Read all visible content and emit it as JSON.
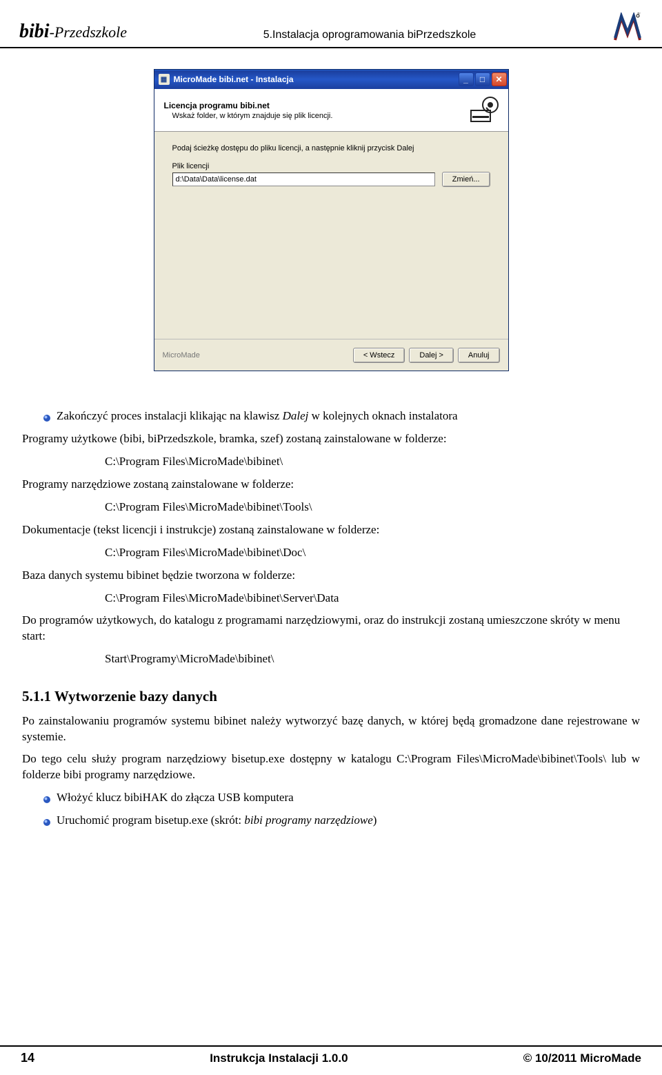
{
  "header": {
    "left_prefix": "bibi",
    "left_suffix": "-Przedszkole",
    "center": "5.Instalacja oprogramowania biPrzedszkole"
  },
  "installer": {
    "title": "MicroMade bibi.net - Instalacja",
    "wiz_title": "Licencja programu bibi.net",
    "wiz_sub": "Wskaż folder, w którym znajduje się plik licencji.",
    "instr": "Podaj ścieżkę dostępu do pliku licencji, a następnie kliknij przycisk Dalej",
    "field_label": "Plik licencji",
    "path_value": "d:\\Data\\Data\\license.dat",
    "btn_change": "Zmień...",
    "brand_footer": "MicroMade",
    "btn_back": "< Wstecz",
    "btn_next": "Dalej >",
    "btn_cancel": "Anuluj"
  },
  "bullets": {
    "b1": "Zakończyć proces instalacji klikając na klawisz ",
    "b1_em": "Dalej",
    "b1_tail": " w kolejnych oknach instalatora",
    "b2": "Włożyć klucz bibiHAK do złącza USB komputera",
    "b3_pre": "Uruchomić program bisetup.exe (skrót: ",
    "b3_em": "bibi programy narzędziowe",
    "b3_tail": ")"
  },
  "text": {
    "p1": "Programy użytkowe (bibi, biPrzedszkole, bramka, szef) zostaną zainstalowane w folderze:",
    "path1": "C:\\Program Files\\MicroMade\\bibinet\\",
    "p2": "Programy narzędziowe zostaną zainstalowane w folderze:",
    "path2": "C:\\Program Files\\MicroMade\\bibinet\\Tools\\",
    "p3": "Dokumentacje (tekst licencji i instrukcje) zostaną zainstalowane w folderze:",
    "path3": "C:\\Program Files\\MicroMade\\bibinet\\Doc\\",
    "p4": "Baza danych systemu bibinet będzie tworzona w folderze:",
    "path4": "C:\\Program Files\\MicroMade\\bibinet\\Server\\Data",
    "p5": "Do programów użytkowych, do katalogu z programami narzędziowymi, oraz do instrukcji zostaną umieszczone skróty w menu start:",
    "path5": "Start\\Programy\\MicroMade\\bibinet\\",
    "h2": "5.1.1 Wytworzenie bazy danych",
    "p6": "Po zainstalowaniu programów systemu bibinet należy wytworzyć bazę danych, w której będą gromadzone dane rejestrowane w systemie.",
    "p7": "Do tego celu służy program narzędziowy bisetup.exe dostępny w katalogu C:\\Program Files\\MicroMade\\bibinet\\Tools\\ lub w folderze bibi programy narzędziowe."
  },
  "footer": {
    "page": "14",
    "center": "Instrukcja Instalacji   1.0.0",
    "right": "© 10/2011 MicroMade"
  }
}
